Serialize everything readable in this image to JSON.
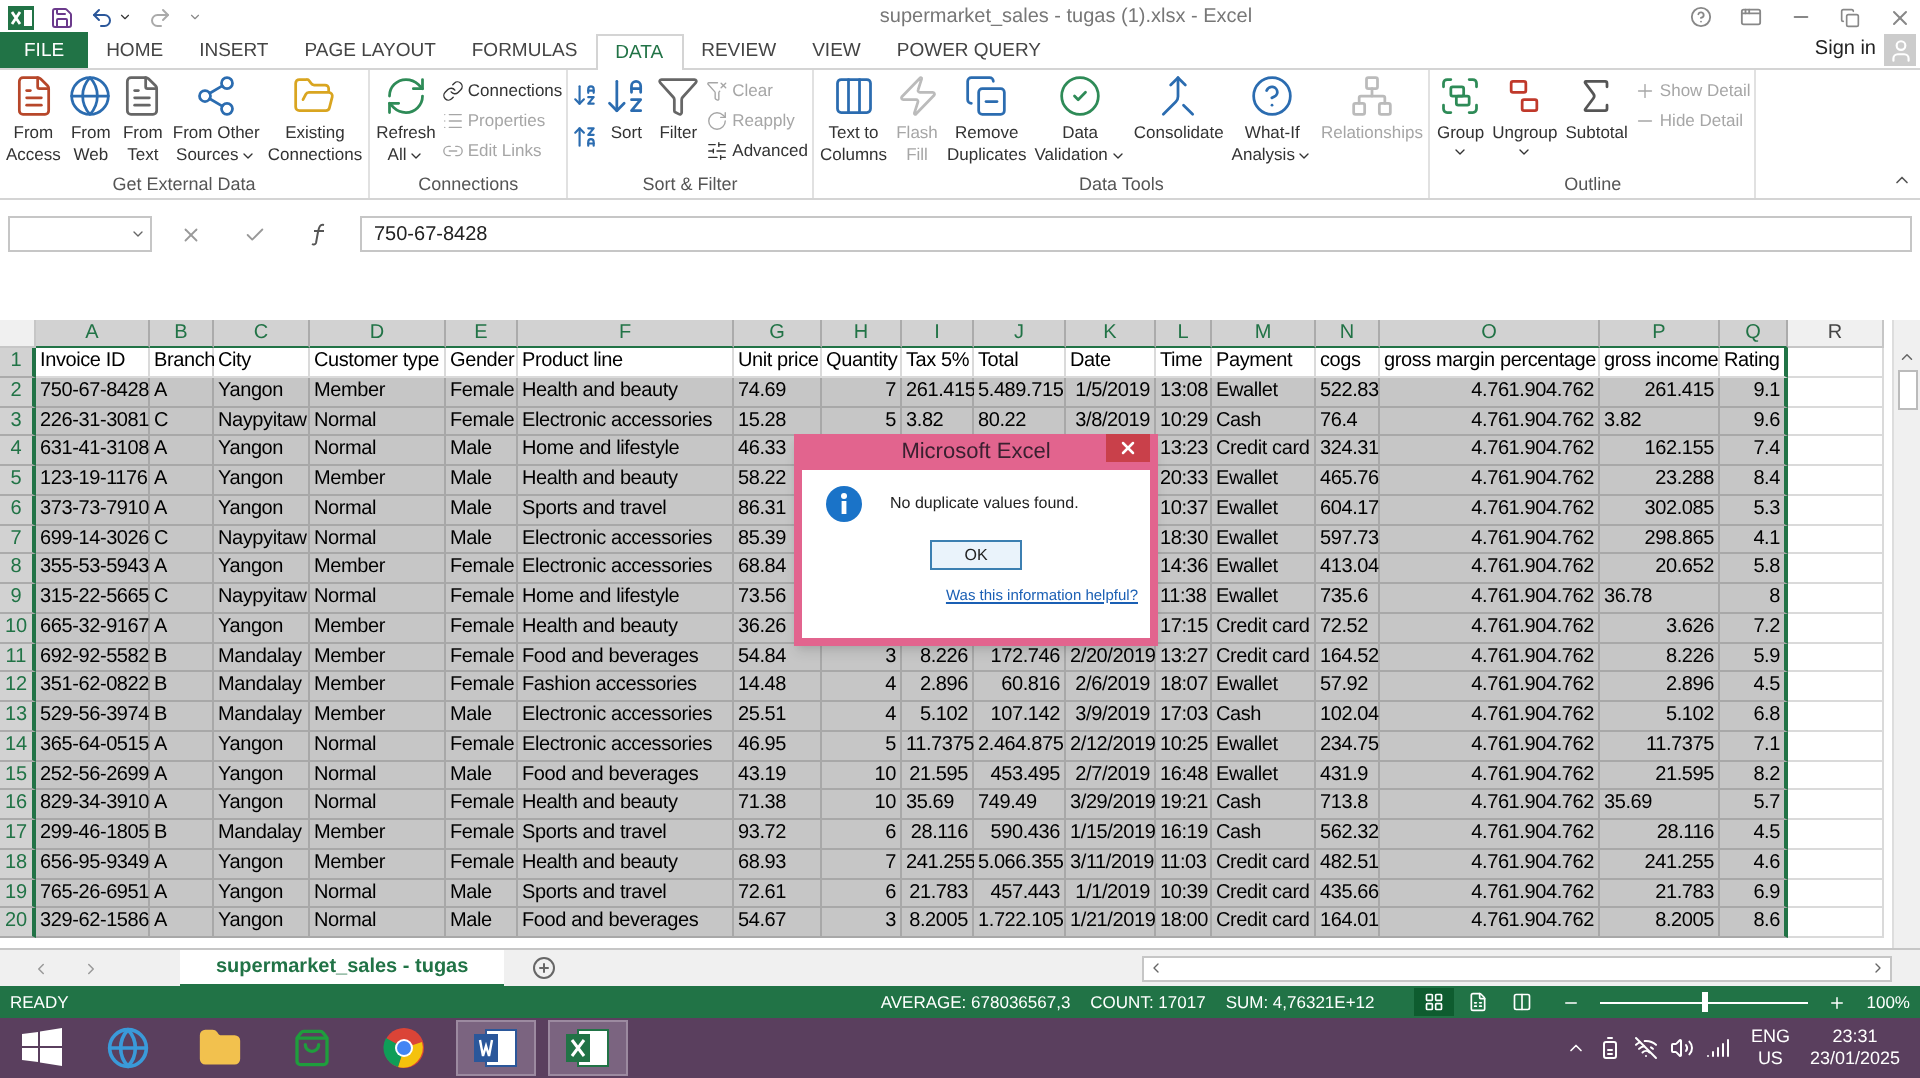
{
  "window": {
    "title": "supermarket_sales - tugas (1).xlsx - Excel"
  },
  "ribbon_tabs": [
    {
      "label": "FILE",
      "kind": "file",
      "selected": false
    },
    {
      "label": "HOME",
      "kind": "tab",
      "selected": false
    },
    {
      "label": "INSERT",
      "kind": "tab",
      "selected": false
    },
    {
      "label": "PAGE LAYOUT",
      "kind": "tab",
      "selected": false
    },
    {
      "label": "FORMULAS",
      "kind": "tab",
      "selected": false
    },
    {
      "label": "DATA",
      "kind": "tab",
      "selected": true
    },
    {
      "label": "REVIEW",
      "kind": "tab",
      "selected": false
    },
    {
      "label": "VIEW",
      "kind": "tab",
      "selected": false
    },
    {
      "label": "POWER QUERY",
      "kind": "tab",
      "selected": false
    }
  ],
  "sign_in": "Sign in",
  "ribbon_groups": [
    {
      "label": "Get External Data",
      "items": [
        {
          "kind": "large",
          "lines": [
            "From",
            "Access"
          ],
          "dropdown": false,
          "disabled": false
        },
        {
          "kind": "large",
          "lines": [
            "From",
            "Web"
          ],
          "dropdown": false,
          "disabled": false
        },
        {
          "kind": "large",
          "lines": [
            "From",
            "Text"
          ],
          "dropdown": false,
          "disabled": false
        },
        {
          "kind": "large",
          "lines": [
            "From Other",
            "Sources"
          ],
          "dropdown": true,
          "disabled": false
        },
        {
          "kind": "large",
          "lines": [
            "Existing",
            "Connections"
          ],
          "dropdown": false,
          "disabled": false
        }
      ]
    },
    {
      "label": "Connections",
      "items": [
        {
          "kind": "large",
          "lines": [
            "Refresh",
            "All"
          ],
          "dropdown": true,
          "disabled": false
        },
        {
          "kind": "small_stack",
          "entries": [
            {
              "label": "Connections",
              "disabled": false
            },
            {
              "label": "Properties",
              "disabled": true
            },
            {
              "label": "Edit Links",
              "disabled": true
            }
          ]
        }
      ]
    },
    {
      "label": "Sort & Filter",
      "items": [
        {
          "kind": "sort_pair"
        },
        {
          "kind": "large",
          "lines": [
            "Sort"
          ],
          "dropdown": false,
          "disabled": false
        },
        {
          "kind": "large",
          "lines": [
            "Filter"
          ],
          "dropdown": false,
          "disabled": false
        },
        {
          "kind": "small_stack",
          "entries": [
            {
              "label": "Clear",
              "disabled": true
            },
            {
              "label": "Reapply",
              "disabled": true
            },
            {
              "label": "Advanced",
              "disabled": false
            }
          ]
        }
      ]
    },
    {
      "label": "Data Tools",
      "items": [
        {
          "kind": "large",
          "lines": [
            "Text to",
            "Columns"
          ],
          "dropdown": false,
          "disabled": false
        },
        {
          "kind": "large",
          "lines": [
            "Flash",
            "Fill"
          ],
          "dropdown": false,
          "disabled": true
        },
        {
          "kind": "large",
          "lines": [
            "Remove",
            "Duplicates"
          ],
          "dropdown": false,
          "disabled": false
        },
        {
          "kind": "large",
          "lines": [
            "Data",
            "Validation"
          ],
          "dropdown": true,
          "disabled": false
        },
        {
          "kind": "large",
          "lines": [
            "Consolidate"
          ],
          "dropdown": false,
          "disabled": false
        },
        {
          "kind": "large",
          "lines": [
            "What-If",
            "Analysis"
          ],
          "dropdown": true,
          "disabled": false
        },
        {
          "kind": "large",
          "lines": [
            "Relationships"
          ],
          "dropdown": false,
          "disabled": true
        }
      ]
    },
    {
      "label": "Outline",
      "items": [
        {
          "kind": "large",
          "lines": [
            "Group"
          ],
          "dropdown": true,
          "disabled": false
        },
        {
          "kind": "large",
          "lines": [
            "Ungroup"
          ],
          "dropdown": true,
          "disabled": false
        },
        {
          "kind": "large",
          "lines": [
            "Subtotal"
          ],
          "dropdown": false,
          "disabled": false
        },
        {
          "kind": "small_stack",
          "entries": [
            {
              "label": "Show Detail",
              "disabled": true
            },
            {
              "label": "Hide Detail",
              "disabled": true
            }
          ]
        }
      ]
    }
  ],
  "formula_bar": {
    "value": "750-67-8428"
  },
  "sheet": {
    "columns": [
      {
        "letter": "A",
        "selected": true,
        "right_aligned": false
      },
      {
        "letter": "B",
        "selected": true,
        "right_aligned": false
      },
      {
        "letter": "C",
        "selected": true,
        "right_aligned": false
      },
      {
        "letter": "D",
        "selected": true,
        "right_aligned": false
      },
      {
        "letter": "E",
        "selected": true,
        "right_aligned": false
      },
      {
        "letter": "F",
        "selected": true,
        "right_aligned": false
      },
      {
        "letter": "G",
        "selected": true,
        "right_aligned": false
      },
      {
        "letter": "H",
        "selected": true,
        "right_aligned": true
      },
      {
        "letter": "I",
        "selected": true,
        "right_aligned": true
      },
      {
        "letter": "J",
        "selected": true,
        "right_aligned": true
      },
      {
        "letter": "K",
        "selected": true,
        "right_aligned": true
      },
      {
        "letter": "L",
        "selected": true,
        "right_aligned": true
      },
      {
        "letter": "M",
        "selected": true,
        "right_aligned": false
      },
      {
        "letter": "N",
        "selected": true,
        "right_aligned": false
      },
      {
        "letter": "O",
        "selected": true,
        "right_aligned": true
      },
      {
        "letter": "P",
        "selected": true,
        "right_aligned": true
      },
      {
        "letter": "Q",
        "selected": true,
        "right_aligned": true
      },
      {
        "letter": "R",
        "selected": false
      }
    ],
    "rows": [
      {
        "number": "1",
        "kind": "header",
        "cells": [
          "Invoice ID",
          "Branch",
          "City",
          "Customer type",
          "Gender",
          "Product line",
          "Unit price",
          "Quantity",
          "Tax 5%",
          "Total",
          "Date",
          "Time",
          "Payment",
          "cogs",
          "gross margin percentage",
          "gross income",
          "Rating"
        ]
      },
      {
        "number": "2",
        "kind": "data",
        "cells": [
          "750-67-8428",
          "A",
          "Yangon",
          "Member",
          "Female",
          "Health and beauty",
          "74.69",
          "7",
          "261.415",
          "5.489.715",
          "1/5/2019",
          "13:08",
          "Ewallet",
          "522.83",
          "4.761.904.762",
          "261.415",
          "9.1"
        ]
      },
      {
        "number": "3",
        "kind": "data",
        "cells": [
          "226-31-3081",
          "C",
          "Naypyitaw",
          "Normal",
          "Female",
          "Electronic accessories",
          "15.28",
          "5",
          {
            "text": "3.82",
            "right_aligned": false
          },
          {
            "text": "80.22",
            "right_aligned": false
          },
          "3/8/2019",
          "10:29",
          "Cash",
          "76.4",
          "4.761.904.762",
          {
            "text": "3.82",
            "right_aligned": false
          },
          "9.6"
        ]
      },
      {
        "number": "4",
        "kind": "data",
        "cells": [
          "631-41-3108",
          "A",
          "Yangon",
          "Normal",
          "Male",
          "Home and lifestyle",
          "46.33",
          null,
          null,
          null,
          null,
          "13:23",
          "Credit card",
          "324.31",
          "4.761.904.762",
          "162.155",
          "7.4"
        ]
      },
      {
        "number": "5",
        "kind": "data",
        "cells": [
          "123-19-1176",
          "A",
          "Yangon",
          "Member",
          "Male",
          "Health and beauty",
          "58.22",
          null,
          null,
          null,
          null,
          "20:33",
          "Ewallet",
          "465.76",
          "4.761.904.762",
          "23.288",
          "8.4"
        ]
      },
      {
        "number": "6",
        "kind": "data",
        "cells": [
          "373-73-7910",
          "A",
          "Yangon",
          "Normal",
          "Male",
          "Sports and travel",
          "86.31",
          null,
          null,
          null,
          null,
          "10:37",
          "Ewallet",
          "604.17",
          "4.761.904.762",
          "302.085",
          "5.3"
        ]
      },
      {
        "number": "7",
        "kind": "data",
        "cells": [
          "699-14-3026",
          "C",
          "Naypyitaw",
          "Normal",
          "Male",
          "Electronic accessories",
          "85.39",
          null,
          null,
          null,
          null,
          "18:30",
          "Ewallet",
          "597.73",
          "4.761.904.762",
          "298.865",
          "4.1"
        ]
      },
      {
        "number": "8",
        "kind": "data",
        "cells": [
          "355-53-5943",
          "A",
          "Yangon",
          "Member",
          "Female",
          "Electronic accessories",
          "68.84",
          null,
          null,
          null,
          null,
          "14:36",
          "Ewallet",
          "413.04",
          "4.761.904.762",
          "20.652",
          "5.8"
        ]
      },
      {
        "number": "9",
        "kind": "data",
        "cells": [
          "315-22-5665",
          "C",
          "Naypyitaw",
          "Normal",
          "Female",
          "Home and lifestyle",
          "73.56",
          null,
          null,
          null,
          null,
          "11:38",
          "Ewallet",
          "735.6",
          "4.761.904.762",
          {
            "text": "36.78",
            "right_aligned": false
          },
          "8"
        ]
      },
      {
        "number": "10",
        "kind": "data",
        "cells": [
          "665-32-9167",
          "A",
          "Yangon",
          "Member",
          "Female",
          "Health and beauty",
          "36.26",
          null,
          null,
          null,
          null,
          "17:15",
          "Credit card",
          "72.52",
          "4.761.904.762",
          "3.626",
          "7.2"
        ]
      },
      {
        "number": "11",
        "kind": "data",
        "cells": [
          "692-92-5582",
          "B",
          "Mandalay",
          "Member",
          "Female",
          "Food and beverages",
          "54.84",
          "3",
          "8.226",
          "172.746",
          "2/20/2019",
          "13:27",
          "Credit card",
          "164.52",
          "4.761.904.762",
          "8.226",
          "5.9"
        ]
      },
      {
        "number": "12",
        "kind": "data",
        "cells": [
          "351-62-0822",
          "B",
          "Mandalay",
          "Member",
          "Female",
          "Fashion accessories",
          "14.48",
          "4",
          "2.896",
          "60.816",
          "2/6/2019",
          "18:07",
          "Ewallet",
          "57.92",
          "4.761.904.762",
          "2.896",
          "4.5"
        ]
      },
      {
        "number": "13",
        "kind": "data",
        "cells": [
          "529-56-3974",
          "B",
          "Mandalay",
          "Member",
          "Male",
          "Electronic accessories",
          "25.51",
          "4",
          "5.102",
          "107.142",
          "3/9/2019",
          "17:03",
          "Cash",
          "102.04",
          "4.761.904.762",
          "5.102",
          "6.8"
        ]
      },
      {
        "number": "14",
        "kind": "data",
        "cells": [
          "365-64-0515",
          "A",
          "Yangon",
          "Normal",
          "Female",
          "Electronic accessories",
          "46.95",
          "5",
          "11.7375",
          "2.464.875",
          "2/12/2019",
          "10:25",
          "Ewallet",
          "234.75",
          "4.761.904.762",
          "11.7375",
          "7.1"
        ]
      },
      {
        "number": "15",
        "kind": "data",
        "cells": [
          "252-56-2699",
          "A",
          "Yangon",
          "Normal",
          "Male",
          "Food and beverages",
          "43.19",
          "10",
          "21.595",
          "453.495",
          "2/7/2019",
          "16:48",
          "Ewallet",
          "431.9",
          "4.761.904.762",
          "21.595",
          "8.2"
        ]
      },
      {
        "number": "16",
        "kind": "data",
        "cells": [
          "829-34-3910",
          "A",
          "Yangon",
          "Normal",
          "Female",
          "Health and beauty",
          "71.38",
          "10",
          {
            "text": "35.69",
            "right_aligned": false
          },
          {
            "text": "749.49",
            "right_aligned": false
          },
          "3/29/2019",
          "19:21",
          "Cash",
          "713.8",
          "4.761.904.762",
          {
            "text": "35.69",
            "right_aligned": false
          },
          "5.7"
        ]
      },
      {
        "number": "17",
        "kind": "data",
        "cells": [
          "299-46-1805",
          "B",
          "Mandalay",
          "Member",
          "Female",
          "Sports and travel",
          "93.72",
          "6",
          "28.116",
          "590.436",
          "1/15/2019",
          "16:19",
          "Cash",
          "562.32",
          "4.761.904.762",
          "28.116",
          "4.5"
        ]
      },
      {
        "number": "18",
        "kind": "data",
        "cells": [
          "656-95-9349",
          "A",
          "Yangon",
          "Member",
          "Female",
          "Health and beauty",
          "68.93",
          "7",
          "241.255",
          "5.066.355",
          "3/11/2019",
          "11:03",
          "Credit card",
          "482.51",
          "4.761.904.762",
          "241.255",
          "4.6"
        ]
      },
      {
        "number": "19",
        "kind": "data",
        "cells": [
          "765-26-6951",
          "A",
          "Yangon",
          "Normal",
          "Male",
          "Sports and travel",
          "72.61",
          "6",
          "21.783",
          "457.443",
          "1/1/2019",
          "10:39",
          "Credit card",
          "435.66",
          "4.761.904.762",
          "21.783",
          "6.9"
        ]
      },
      {
        "number": "20",
        "kind": "data",
        "cells": [
          "329-62-1586",
          "A",
          "Yangon",
          "Normal",
          "Male",
          "Food and beverages",
          "54.67",
          "3",
          "8.2005",
          "1.722.105",
          "1/21/2019",
          "18:00",
          "Credit card",
          "164.01",
          "4.761.904.762",
          "8.2005",
          "8.6"
        ]
      }
    ]
  },
  "dialog": {
    "title": "Microsoft Excel",
    "message": "No duplicate values found.",
    "button": "OK",
    "link": "Was this information helpful?"
  },
  "sheet_tabs": [
    {
      "label": "supermarket_sales - tugas",
      "selected": true
    }
  ],
  "status_bar": {
    "mode": "READY",
    "average": "AVERAGE: 678036567,3",
    "count": "COUNT: 17017",
    "sum": "SUM: 4,76321E+12",
    "views": [
      {
        "selected": true
      },
      {
        "selected": false
      },
      {
        "selected": false
      }
    ],
    "zoom_slider": {
      "level": 0.5
    },
    "zoom": "100%"
  },
  "taskbar": {
    "apps": [
      {
        "active": false
      },
      {
        "active": false
      },
      {
        "active": false
      },
      {
        "active": false
      },
      {
        "active": true
      },
      {
        "active": true
      }
    ],
    "language": "ENG",
    "region": "US",
    "time": "23:31",
    "date": "23/01/2025"
  }
}
